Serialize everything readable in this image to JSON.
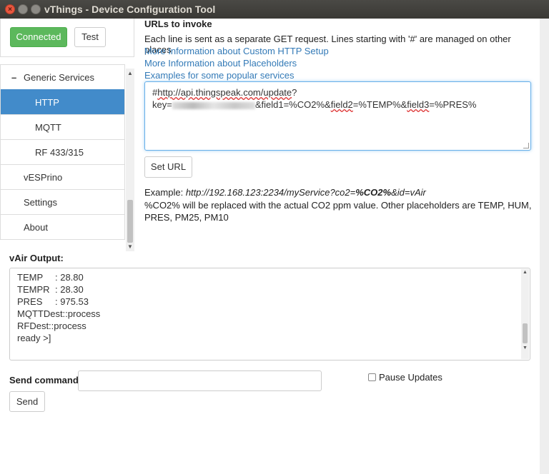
{
  "window": {
    "title": "vThings - Device Configuration Tool"
  },
  "connection": {
    "connected_label": "Connected",
    "test_label": "Test"
  },
  "sidebar": {
    "items": [
      {
        "label": "Generic Services"
      },
      {
        "label": "HTTP"
      },
      {
        "label": "MQTT"
      },
      {
        "label": "RF 433/315"
      },
      {
        "label": "vESPrino"
      },
      {
        "label": "Settings"
      },
      {
        "label": "About"
      }
    ]
  },
  "main": {
    "title": "URLs to invoke",
    "help": "Each line is sent as a separate GET request. Lines starting with '#' are managed on other places",
    "links": [
      "More Information about Custom HTTP Setup",
      "More Information about Placeholders",
      "Examples for some popular services"
    ],
    "url": {
      "line1_prefix": "#",
      "line1_link": "http://api.thingspeak.com/update",
      "line1_suffix": "?",
      "line2_prefix": "key=",
      "line2_rest_a": "&field1=%CO2%&",
      "line2_field2": "field2",
      "line2_rest_b": "=%TEMP%&",
      "line2_field3": "field3",
      "line2_rest_c": "=%PRES%"
    },
    "set_url_label": "Set URL",
    "example_prefix": "Example: ",
    "example_url_a": "http://192.168.123:2234/myService?co2=",
    "example_url_b": "%CO2%",
    "example_url_c": "&id=vAir",
    "note": "%CO2% will be replaced with the actual CO2 ppm value. Other placeholders are TEMP, HUM, PRES, PM25, PM10"
  },
  "output": {
    "label": "vAir Output:",
    "lines": [
      {
        "k": "TEMP",
        "v": ": 28.80"
      },
      {
        "k": "TEMPR",
        "v": ": 28.30"
      },
      {
        "k": "PRES",
        "v": ": 975.53"
      },
      {
        "k": "MQTTDest::process",
        "v": ""
      },
      {
        "k": "RFDest::process",
        "v": ""
      },
      {
        "k": "ready >]",
        "v": ""
      }
    ]
  },
  "command": {
    "label": "Send command:",
    "value": "",
    "send_label": "Send",
    "pause_label": "Pause Updates"
  },
  "colors": {
    "accent": "#428bca",
    "success": "#5cb85c",
    "link": "#337ab7"
  }
}
